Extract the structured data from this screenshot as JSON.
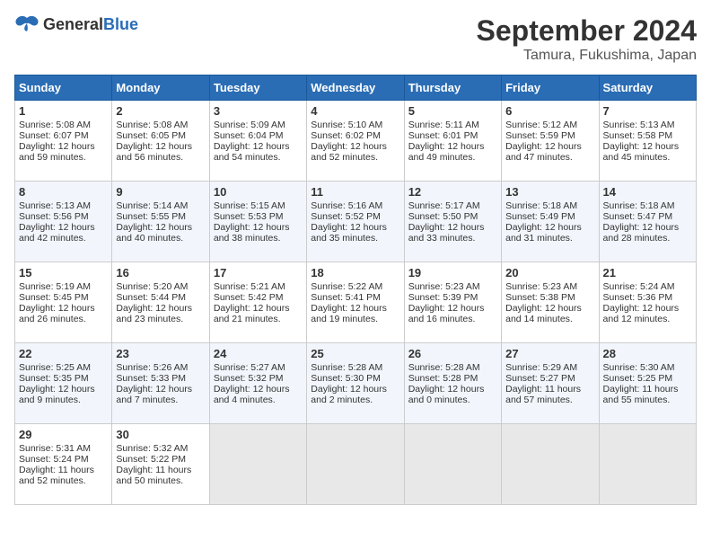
{
  "header": {
    "logo_general": "General",
    "logo_blue": "Blue",
    "month": "September 2024",
    "location": "Tamura, Fukushima, Japan"
  },
  "weekdays": [
    "Sunday",
    "Monday",
    "Tuesday",
    "Wednesday",
    "Thursday",
    "Friday",
    "Saturday"
  ],
  "weeks": [
    [
      {
        "day": "1",
        "data": "Sunrise: 5:08 AM\nSunset: 6:07 PM\nDaylight: 12 hours\nand 59 minutes."
      },
      {
        "day": "2",
        "data": "Sunrise: 5:08 AM\nSunset: 6:05 PM\nDaylight: 12 hours\nand 56 minutes."
      },
      {
        "day": "3",
        "data": "Sunrise: 5:09 AM\nSunset: 6:04 PM\nDaylight: 12 hours\nand 54 minutes."
      },
      {
        "day": "4",
        "data": "Sunrise: 5:10 AM\nSunset: 6:02 PM\nDaylight: 12 hours\nand 52 minutes."
      },
      {
        "day": "5",
        "data": "Sunrise: 5:11 AM\nSunset: 6:01 PM\nDaylight: 12 hours\nand 49 minutes."
      },
      {
        "day": "6",
        "data": "Sunrise: 5:12 AM\nSunset: 5:59 PM\nDaylight: 12 hours\nand 47 minutes."
      },
      {
        "day": "7",
        "data": "Sunrise: 5:13 AM\nSunset: 5:58 PM\nDaylight: 12 hours\nand 45 minutes."
      }
    ],
    [
      {
        "day": "8",
        "data": "Sunrise: 5:13 AM\nSunset: 5:56 PM\nDaylight: 12 hours\nand 42 minutes."
      },
      {
        "day": "9",
        "data": "Sunrise: 5:14 AM\nSunset: 5:55 PM\nDaylight: 12 hours\nand 40 minutes."
      },
      {
        "day": "10",
        "data": "Sunrise: 5:15 AM\nSunset: 5:53 PM\nDaylight: 12 hours\nand 38 minutes."
      },
      {
        "day": "11",
        "data": "Sunrise: 5:16 AM\nSunset: 5:52 PM\nDaylight: 12 hours\nand 35 minutes."
      },
      {
        "day": "12",
        "data": "Sunrise: 5:17 AM\nSunset: 5:50 PM\nDaylight: 12 hours\nand 33 minutes."
      },
      {
        "day": "13",
        "data": "Sunrise: 5:18 AM\nSunset: 5:49 PM\nDaylight: 12 hours\nand 31 minutes."
      },
      {
        "day": "14",
        "data": "Sunrise: 5:18 AM\nSunset: 5:47 PM\nDaylight: 12 hours\nand 28 minutes."
      }
    ],
    [
      {
        "day": "15",
        "data": "Sunrise: 5:19 AM\nSunset: 5:45 PM\nDaylight: 12 hours\nand 26 minutes."
      },
      {
        "day": "16",
        "data": "Sunrise: 5:20 AM\nSunset: 5:44 PM\nDaylight: 12 hours\nand 23 minutes."
      },
      {
        "day": "17",
        "data": "Sunrise: 5:21 AM\nSunset: 5:42 PM\nDaylight: 12 hours\nand 21 minutes."
      },
      {
        "day": "18",
        "data": "Sunrise: 5:22 AM\nSunset: 5:41 PM\nDaylight: 12 hours\nand 19 minutes."
      },
      {
        "day": "19",
        "data": "Sunrise: 5:23 AM\nSunset: 5:39 PM\nDaylight: 12 hours\nand 16 minutes."
      },
      {
        "day": "20",
        "data": "Sunrise: 5:23 AM\nSunset: 5:38 PM\nDaylight: 12 hours\nand 14 minutes."
      },
      {
        "day": "21",
        "data": "Sunrise: 5:24 AM\nSunset: 5:36 PM\nDaylight: 12 hours\nand 12 minutes."
      }
    ],
    [
      {
        "day": "22",
        "data": "Sunrise: 5:25 AM\nSunset: 5:35 PM\nDaylight: 12 hours\nand 9 minutes."
      },
      {
        "day": "23",
        "data": "Sunrise: 5:26 AM\nSunset: 5:33 PM\nDaylight: 12 hours\nand 7 minutes."
      },
      {
        "day": "24",
        "data": "Sunrise: 5:27 AM\nSunset: 5:32 PM\nDaylight: 12 hours\nand 4 minutes."
      },
      {
        "day": "25",
        "data": "Sunrise: 5:28 AM\nSunset: 5:30 PM\nDaylight: 12 hours\nand 2 minutes."
      },
      {
        "day": "26",
        "data": "Sunrise: 5:28 AM\nSunset: 5:28 PM\nDaylight: 12 hours\nand 0 minutes."
      },
      {
        "day": "27",
        "data": "Sunrise: 5:29 AM\nSunset: 5:27 PM\nDaylight: 11 hours\nand 57 minutes."
      },
      {
        "day": "28",
        "data": "Sunrise: 5:30 AM\nSunset: 5:25 PM\nDaylight: 11 hours\nand 55 minutes."
      }
    ],
    [
      {
        "day": "29",
        "data": "Sunrise: 5:31 AM\nSunset: 5:24 PM\nDaylight: 11 hours\nand 52 minutes."
      },
      {
        "day": "30",
        "data": "Sunrise: 5:32 AM\nSunset: 5:22 PM\nDaylight: 11 hours\nand 50 minutes."
      },
      {
        "day": "",
        "data": ""
      },
      {
        "day": "",
        "data": ""
      },
      {
        "day": "",
        "data": ""
      },
      {
        "day": "",
        "data": ""
      },
      {
        "day": "",
        "data": ""
      }
    ]
  ]
}
